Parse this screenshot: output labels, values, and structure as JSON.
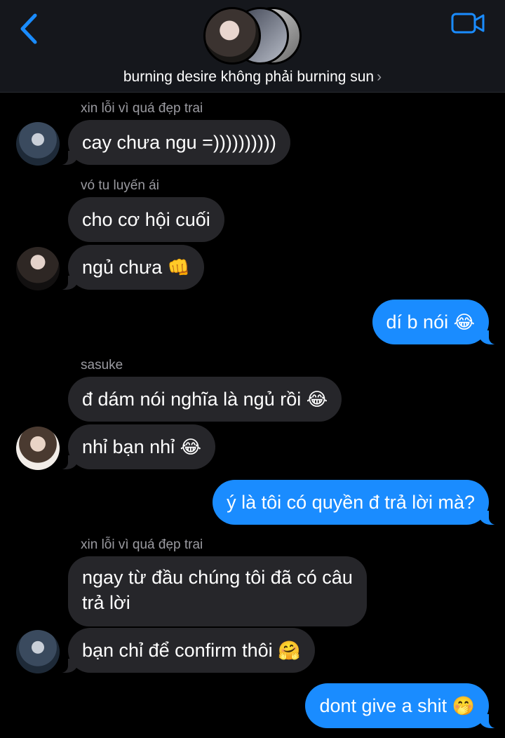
{
  "header": {
    "title": "burning desire không phải burning sun",
    "chevron": "›",
    "back_icon": "chevron-left-icon",
    "video_icon": "video-camera-icon",
    "accent": "#1a8cff"
  },
  "messages": [
    {
      "sender": "xin lỗi vì quá đẹp trai",
      "text": "cay chưa ngu =))))))))))"
    },
    {
      "sender": "vó tu luyến ái",
      "text": "cho cơ hội cuối"
    },
    {
      "text": "ngủ chưa",
      "emoji": "👊"
    },
    {
      "text": "dí b nói",
      "emoji": "😂"
    },
    {
      "sender": "sasuke",
      "text": "đ dám nói nghĩa là ngủ rồi",
      "emoji": "😂"
    },
    {
      "text": "nhỉ bạn nhỉ",
      "emoji": "😂"
    },
    {
      "text": "ý là tôi có quyền đ trả lời mà?"
    },
    {
      "sender": "xin lỗi vì quá đẹp trai",
      "text": "ngay từ đầu chúng tôi đã có câu trả lời"
    },
    {
      "text": "bạn chỉ để confirm thôi",
      "emoji": "🤗"
    },
    {
      "text": "dont give a shit",
      "emoji": "🤭"
    }
  ]
}
